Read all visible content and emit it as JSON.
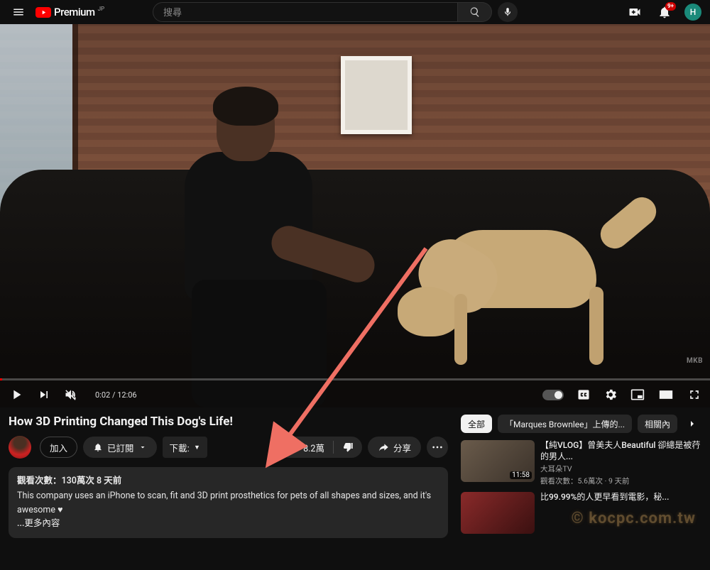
{
  "header": {
    "brand": "Premium",
    "country_code": "JP",
    "search_placeholder": "搜尋",
    "notifications_badge": "9+",
    "avatar_letter": "H"
  },
  "player": {
    "time_label": "0:02 / 12:06",
    "watermark": "MKB"
  },
  "video": {
    "title": "How 3D Printing Changed This Dog's Life!"
  },
  "actions": {
    "join": "加入",
    "subscribed": "已訂閱",
    "download": "下載:",
    "download_caret": "▼",
    "likes": "8.2萬",
    "share": "分享"
  },
  "description": {
    "meta": "觀看次數：130萬次  8 天前",
    "body": "This company uses an iPhone to scan, fit and 3D print prosthetics for pets of all shapes and sizes, and it's awesome ♥",
    "more": "...更多內容"
  },
  "chips": {
    "all": "全部",
    "uploaded_by": "「Marques Brownlee」上傳的...",
    "related": "相關內"
  },
  "related": [
    {
      "title": "【純VLOG】曾美夫人Beautiful     卻總是被荇的男人...",
      "channel": "大耳朵TV",
      "stats": "觀看次數：5.6萬次 · 9 天前",
      "duration": "11:58"
    },
    {
      "title": "比99.99%的人更早看到電影，秘...",
      "channel": "",
      "stats": "",
      "duration": ""
    }
  ],
  "watermark_site": "© kocpc.com.tw"
}
